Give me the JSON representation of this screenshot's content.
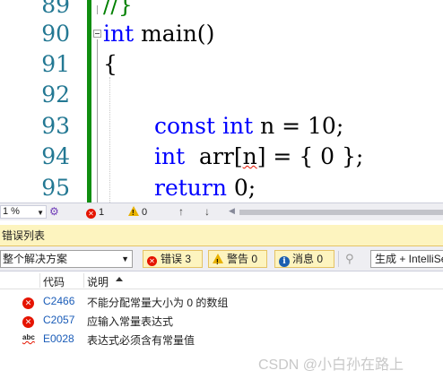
{
  "editor": {
    "line_numbers": [
      "89",
      "90",
      "91",
      "92",
      "93",
      "94",
      "95"
    ],
    "lines": {
      "l89": "//}",
      "l90_kw": "int",
      "l90_fn": " main()",
      "l91": "{",
      "l93_kw1": "const",
      "l93_kw2": "int",
      "l93_rest": " n = 10;",
      "l94_kw": "int",
      "l94_a": "  arr[",
      "l94_n": "n",
      "l94_b": "] = { 0 };",
      "l95_kw": "return",
      "l95_rest": " 0;"
    }
  },
  "status_bar": {
    "zoom": "1 %",
    "error_count": "1",
    "warning_count": "0"
  },
  "error_list": {
    "title": "错误列表",
    "scope": "整个解决方案",
    "filters": {
      "errors": "错误 3",
      "warnings": "警告 0",
      "messages": "消息 0"
    },
    "build_source": "生成 + IntelliSense",
    "columns": {
      "code": "代码",
      "description": "说明"
    },
    "rows": [
      {
        "icon": "error-icon",
        "code": "C2466",
        "description": "不能分配常量大小为 0 的数组"
      },
      {
        "icon": "error-icon",
        "code": "C2057",
        "description": "应输入常量表达式"
      },
      {
        "icon": "intellisense-error-icon",
        "code": "E0028",
        "description": "表达式必须含有常量值"
      }
    ]
  },
  "watermark": "CSDN @小白孙在路上",
  "colors": {
    "keyword": "#0000ff",
    "line_number": "#237893",
    "change_bar": "#108e10",
    "error": "#e51400",
    "warning": "#e8b200",
    "panel_title_bg": "#fdf4bf"
  }
}
